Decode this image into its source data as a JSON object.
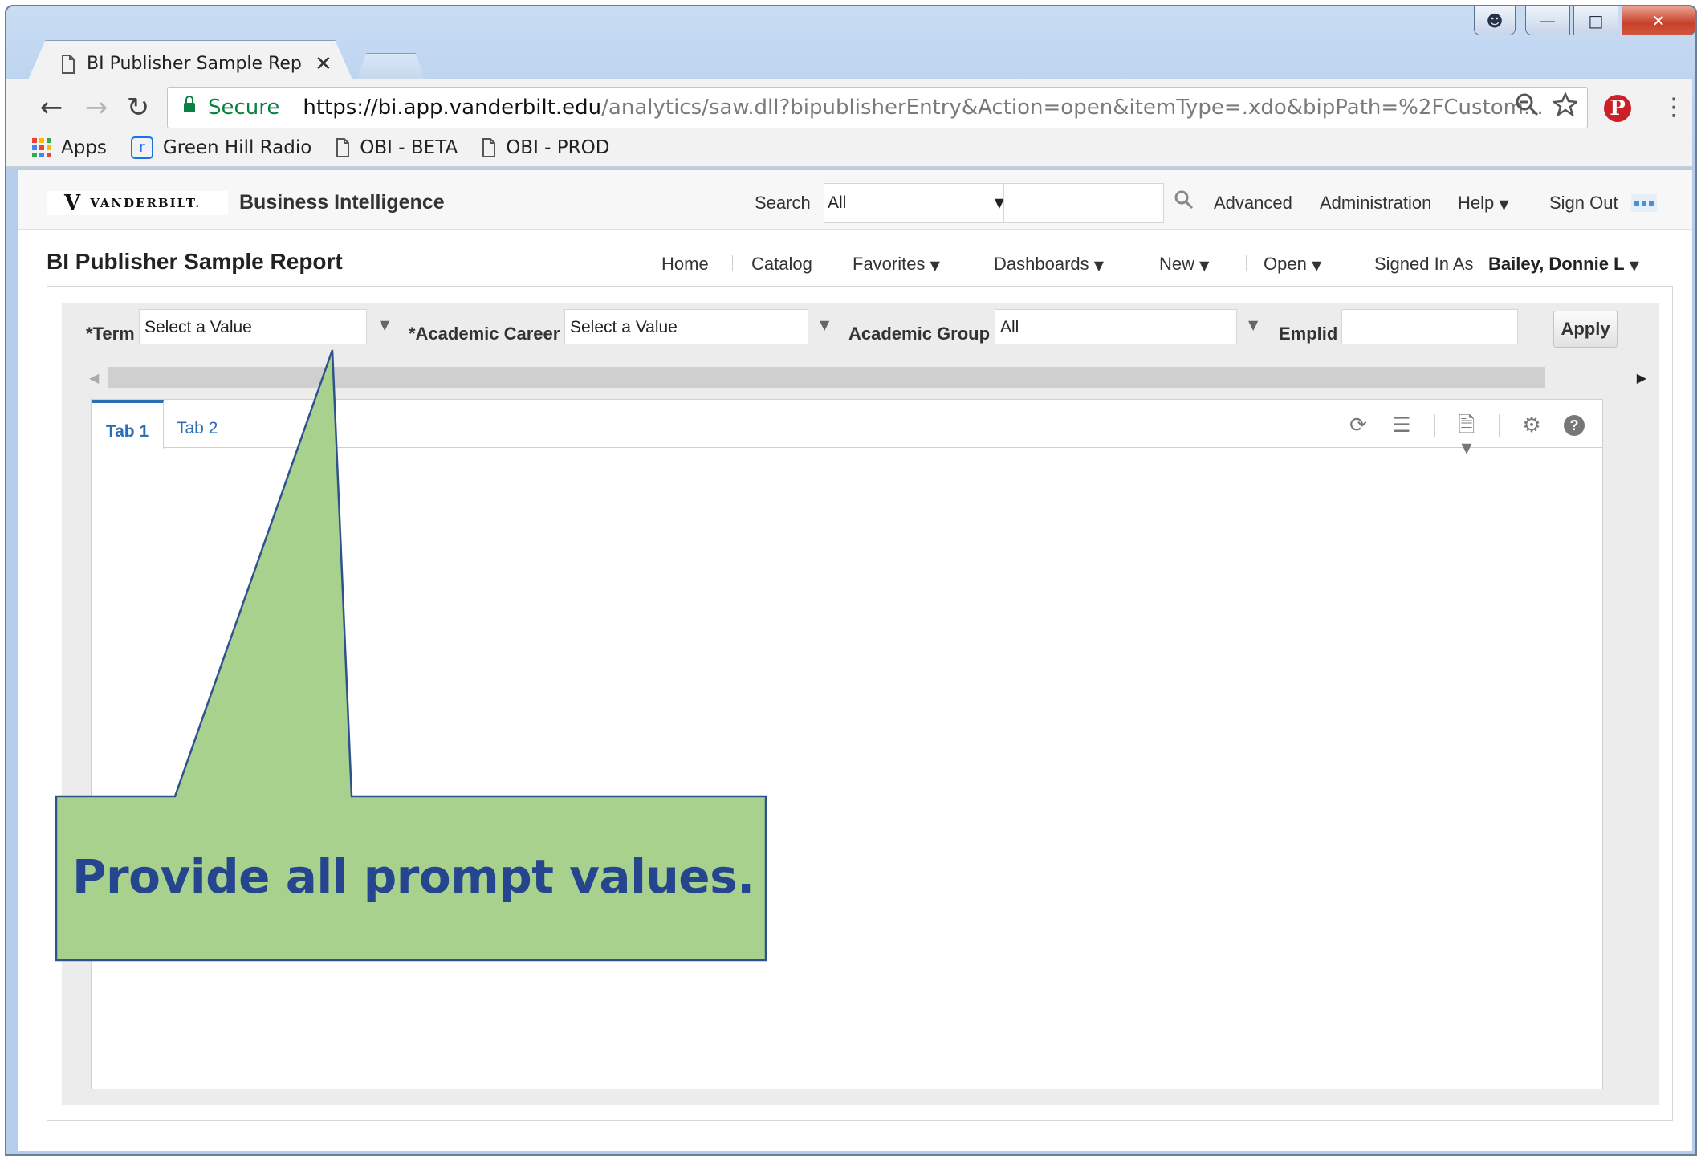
{
  "browser": {
    "tab_title": "BI Publisher Sample Repo",
    "tab_close": "✕",
    "secure_label": "Secure",
    "url_host": "https://bi.app.vanderbilt.edu",
    "url_rest": "/analytics/saw.dll?bipublisherEntry&Action=open&itemType=.xdo&bipPath=%2FCustom...",
    "bookmarks": [
      {
        "label": "Apps",
        "icon": "apps-grid-icon"
      },
      {
        "label": "Green Hill Radio",
        "icon": "radio-r-icon"
      },
      {
        "label": "OBI - BETA",
        "icon": "page-icon"
      },
      {
        "label": "OBI - PROD",
        "icon": "page-icon"
      }
    ]
  },
  "header": {
    "logo_text": "VANDERBILT.",
    "product": "Business Intelligence",
    "search_label": "Search",
    "search_scope": "All",
    "links": [
      "Advanced",
      "Administration",
      "Help",
      "Sign Out"
    ]
  },
  "dashboard": {
    "title": "BI Publisher Sample Report",
    "menu": [
      "Home",
      "Catalog",
      "Favorites",
      "Dashboards",
      "New",
      "Open"
    ],
    "signed_in_label": "Signed In As",
    "user": "Bailey, Donnie L"
  },
  "prompts": {
    "term_label": "*Term",
    "term_value": "Select a Value",
    "career_label": "*Academic Career",
    "career_value": "Select a Value",
    "group_label": "Academic Group",
    "group_value": "All",
    "emplid_label": "Emplid",
    "emplid_value": "",
    "apply_label": "Apply"
  },
  "report": {
    "tabs": [
      "Tab 1",
      "Tab 2"
    ],
    "active_tab": "Tab 1"
  },
  "annotation": {
    "text": "Provide all prompt values.",
    "fill": "#a9d18e",
    "border": "#2f528f",
    "text_color": "#25458e"
  }
}
